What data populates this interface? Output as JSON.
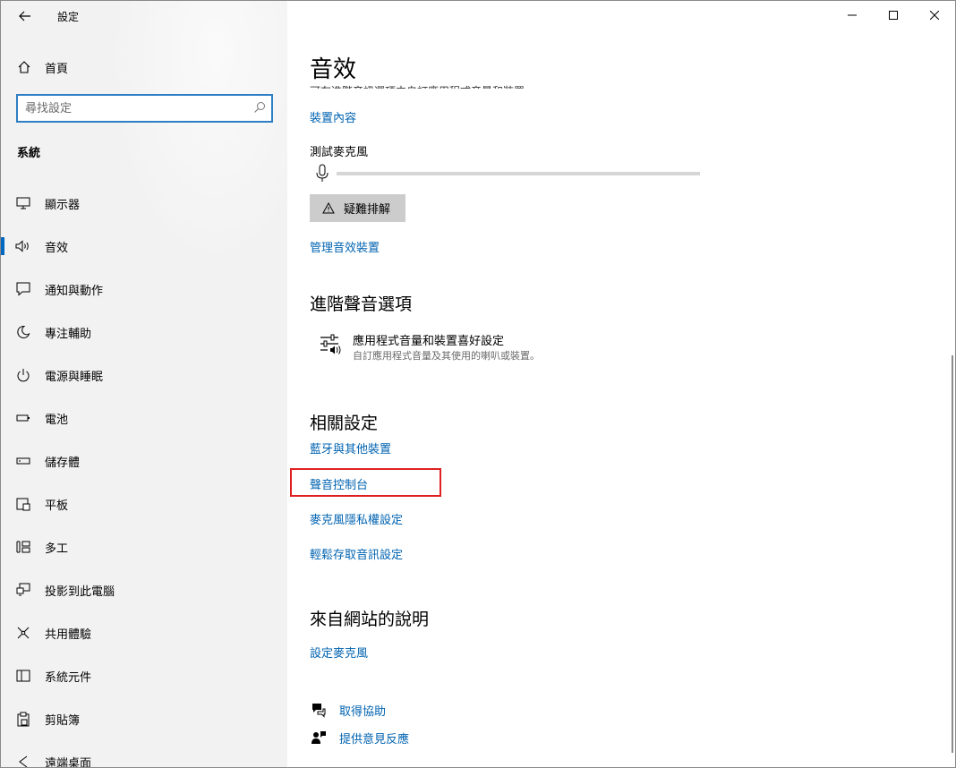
{
  "window": {
    "app_title": "設定",
    "minimize_label": "Minimize",
    "maximize_label": "Maximize",
    "close_label": "Close"
  },
  "sidebar": {
    "home_label": "首頁",
    "search_placeholder": "尋找設定",
    "section_label": "系統",
    "items": [
      {
        "label": "顯示器",
        "icon": "monitor-icon"
      },
      {
        "label": "音效",
        "icon": "speaker-icon",
        "active": true
      },
      {
        "label": "通知與動作",
        "icon": "notification-icon"
      },
      {
        "label": "專注輔助",
        "icon": "moon-icon"
      },
      {
        "label": "電源與睡眠",
        "icon": "power-icon"
      },
      {
        "label": "電池",
        "icon": "battery-icon"
      },
      {
        "label": "儲存體",
        "icon": "storage-icon"
      },
      {
        "label": "平板",
        "icon": "tablet-icon"
      },
      {
        "label": "多工",
        "icon": "multitask-icon"
      },
      {
        "label": "投影到此電腦",
        "icon": "project-icon"
      },
      {
        "label": "共用體驗",
        "icon": "share-icon"
      },
      {
        "label": "系統元件",
        "icon": "components-icon"
      },
      {
        "label": "剪貼簿",
        "icon": "clipboard-icon"
      },
      {
        "label": "遠端桌面",
        "icon": "remote-desktop-icon"
      }
    ]
  },
  "main": {
    "title": "音效",
    "cut_text": "可在進階音訊選項中自訂應用程式音量和裝置。",
    "device_props_link": "裝置內容",
    "test_mic_label": "測試麥克風",
    "mic_level": 0,
    "troubleshoot_label": "疑難排解",
    "manage_devices_link": "管理音效裝置",
    "advanced": {
      "heading": "進階聲音選項",
      "item_title": "應用程式音量和裝置喜好設定",
      "item_desc": "自訂應用程式音量及其使用的喇叭或裝置。"
    },
    "related": {
      "heading": "相關設定",
      "links": [
        "藍牙與其他裝置",
        "聲音控制台",
        "麥克風隱私權設定",
        "輕鬆存取音訊設定"
      ]
    },
    "web_help": {
      "heading": "來自網站的說明",
      "link": "設定麥克風"
    },
    "get_help_label": "取得協助",
    "feedback_label": "提供意見反應"
  },
  "colors": {
    "accent": "#0067c0",
    "link": "#0063b1",
    "highlight_box": "#e02020",
    "sidebar_bg": "#f2f2f2"
  }
}
